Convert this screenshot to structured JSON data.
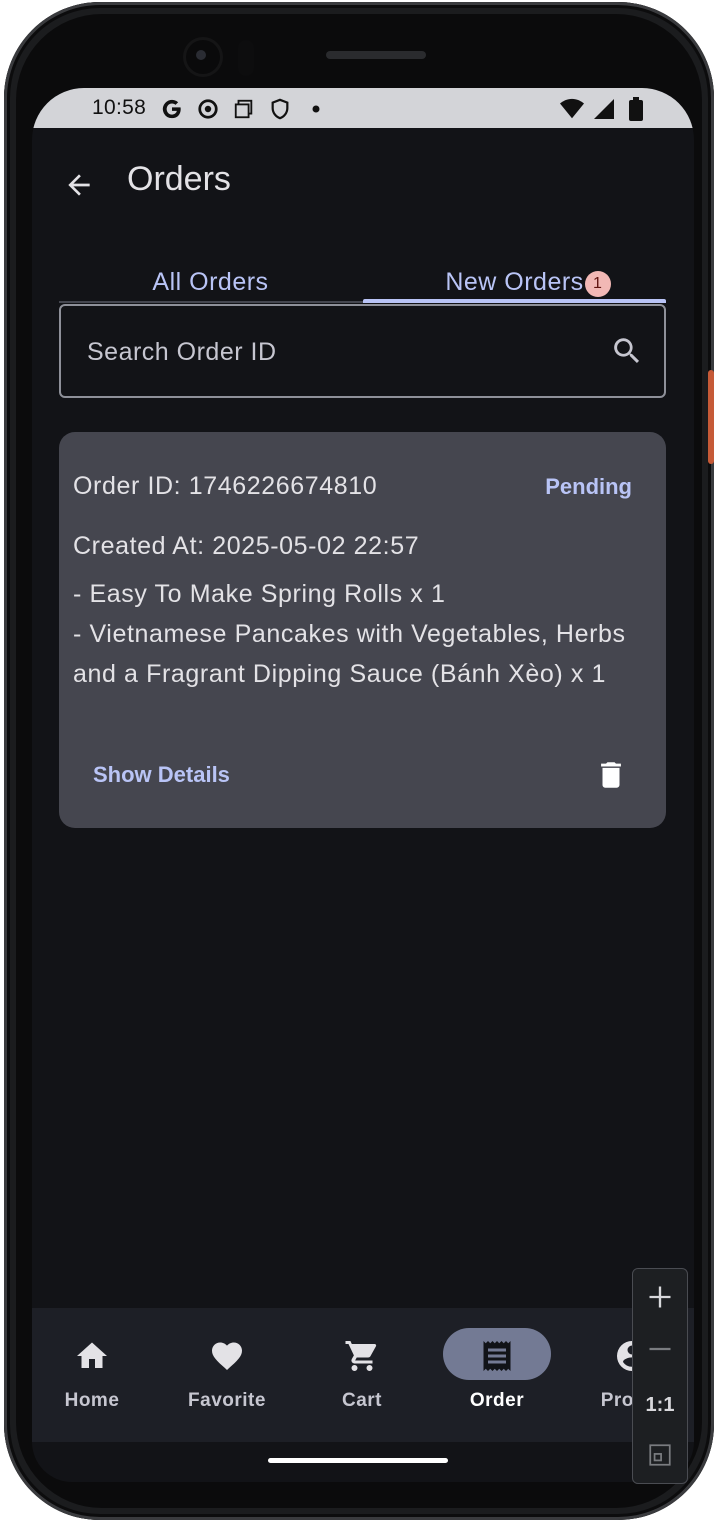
{
  "statusbar": {
    "time": "10:58",
    "left_icons": [
      "google-g-icon",
      "chrome-icon",
      "screenshot-icon",
      "shield-icon",
      "dot-icon"
    ],
    "right_icons": [
      "wifi-icon",
      "signal-icon",
      "battery-icon"
    ]
  },
  "appbar": {
    "title": "Orders"
  },
  "tabs": [
    {
      "label": "All Orders",
      "selected": false
    },
    {
      "label": "New Orders",
      "selected": true,
      "badge": "1"
    }
  ],
  "search": {
    "placeholder": "Search Order ID",
    "value": ""
  },
  "order": {
    "id_text": "Order ID: 1746226674810",
    "status": "Pending",
    "created_text": "Created At: 2025-05-02 22:57",
    "items": [
      "- Easy To Make Spring Rolls x 1",
      "- Vietnamese Pancakes with Vegetables, Herbs and a Fragrant Dipping Sauce (Bánh Xèo) x 1"
    ],
    "show_details_label": "Show Details"
  },
  "bottom_nav": [
    {
      "label": "Home",
      "icon": "home-icon"
    },
    {
      "label": "Favorite",
      "icon": "heart-icon"
    },
    {
      "label": "Cart",
      "icon": "cart-icon"
    },
    {
      "label": "Order",
      "icon": "receipt-icon",
      "active": true
    },
    {
      "label": "Profile",
      "icon": "profile-icon"
    }
  ],
  "emulator_zoom": {
    "reset_label": "1:1"
  },
  "colors": {
    "background": "#121317",
    "card": "#45464f",
    "accent": "#b9c4f6",
    "badge": "#f2b8b5",
    "nav_active_pill": "#737a94"
  }
}
